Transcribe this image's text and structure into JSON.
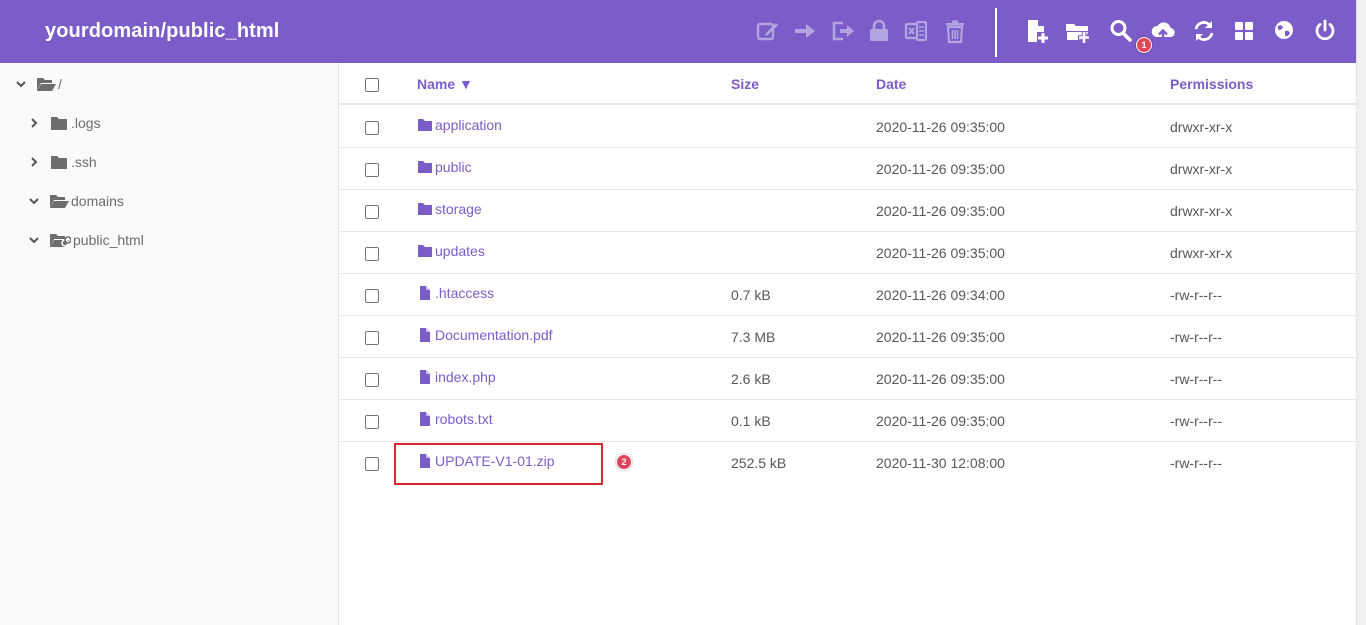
{
  "header": {
    "title": "yourdomain/public_html",
    "accent": "#7c5cc8",
    "toolbar_left": [
      "rename-icon",
      "move-icon",
      "copy-icon",
      "permissions-lock-icon",
      "archive-icon",
      "trash-icon"
    ],
    "toolbar_right": [
      "new-file-icon",
      "new-folder-icon",
      "search-icon",
      "upload-cloud-icon",
      "refresh-icon",
      "grid-view-icon",
      "globe-icon",
      "power-icon"
    ],
    "upload_badge": "1"
  },
  "sidebar": {
    "items": [
      {
        "label": "/",
        "state": "expanded"
      },
      {
        "label": ".logs",
        "state": "collapsed"
      },
      {
        "label": ".ssh",
        "state": "collapsed"
      },
      {
        "label": "domains",
        "state": "expanded"
      },
      {
        "label": "public_html",
        "state": "expanded"
      }
    ]
  },
  "table": {
    "columns": {
      "name": "Name ▼",
      "size": "Size",
      "date": "Date",
      "permissions": "Permissions"
    },
    "rows": [
      {
        "type": "folder",
        "name": "application",
        "size": "",
        "date": "2020-11-26 09:35:00",
        "permissions": "drwxr-xr-x"
      },
      {
        "type": "folder",
        "name": "public",
        "size": "",
        "date": "2020-11-26 09:35:00",
        "permissions": "drwxr-xr-x"
      },
      {
        "type": "folder",
        "name": "storage",
        "size": "",
        "date": "2020-11-26 09:35:00",
        "permissions": "drwxr-xr-x"
      },
      {
        "type": "folder",
        "name": "updates",
        "size": "",
        "date": "2020-11-26 09:35:00",
        "permissions": "drwxr-xr-x"
      },
      {
        "type": "file",
        "name": ".htaccess",
        "size": "0.7 kB",
        "date": "2020-11-26 09:34:00",
        "permissions": "-rw-r--r--"
      },
      {
        "type": "file",
        "name": "Documentation.pdf",
        "size": "7.3 MB",
        "date": "2020-11-26 09:35:00",
        "permissions": "-rw-r--r--"
      },
      {
        "type": "file",
        "name": "index.php",
        "size": "2.6 kB",
        "date": "2020-11-26 09:35:00",
        "permissions": "-rw-r--r--"
      },
      {
        "type": "file",
        "name": "robots.txt",
        "size": "0.1 kB",
        "date": "2020-11-26 09:35:00",
        "permissions": "-rw-r--r--"
      },
      {
        "type": "file",
        "name": "UPDATE-V1-01.zip",
        "size": "252.5 kB",
        "date": "2020-11-30 12:08:00",
        "permissions": "-rw-r--r--"
      }
    ]
  },
  "annotation": {
    "step_badge": "2",
    "highlight_color": "#d9262f"
  }
}
